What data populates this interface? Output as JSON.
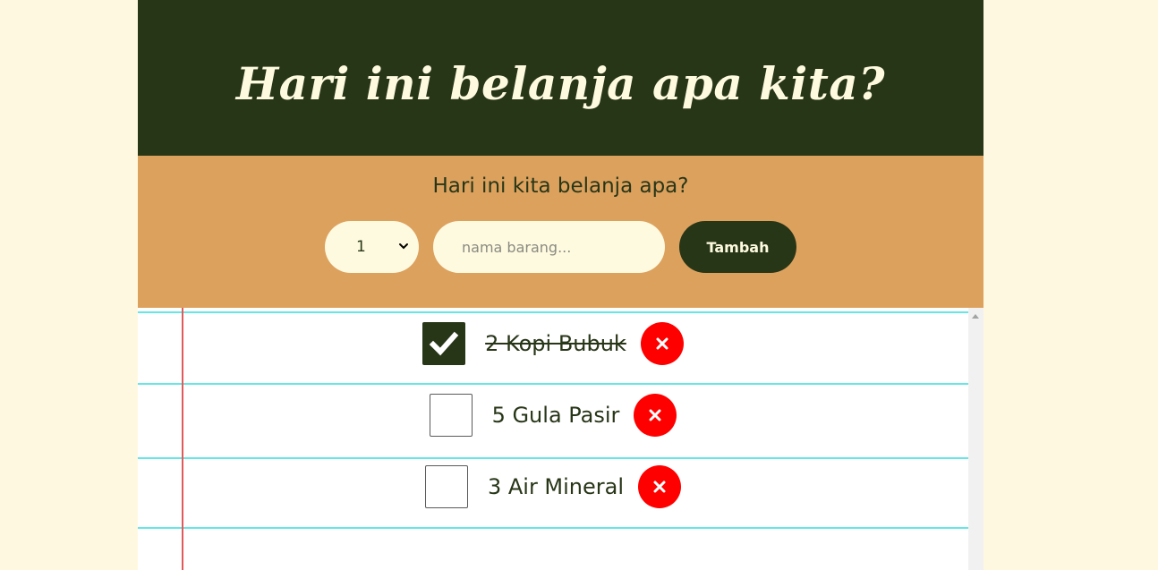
{
  "header": {
    "title": "Hari ini belanja apa kita?"
  },
  "form": {
    "question": "Hari ini kita belanja apa?",
    "quantity_selected": "1",
    "name_placeholder": "nama barang...",
    "add_label": "Tambah"
  },
  "items": [
    {
      "label": "2 Kopi Bubuk",
      "checked": true
    },
    {
      "label": "5 Gula Pasir",
      "checked": false
    },
    {
      "label": "3 Air Mineral",
      "checked": false
    }
  ],
  "colors": {
    "background": "#fff8e0",
    "header": "#283618",
    "form": "#dda15e",
    "input": "#fefae0",
    "delete": "#ff0000",
    "ruled_line": "#66e6e6",
    "margin_line": "#e05a5a"
  },
  "icons": {
    "checkbox_checked": "check-icon",
    "delete": "close-icon",
    "select": "chevron-down-icon"
  }
}
